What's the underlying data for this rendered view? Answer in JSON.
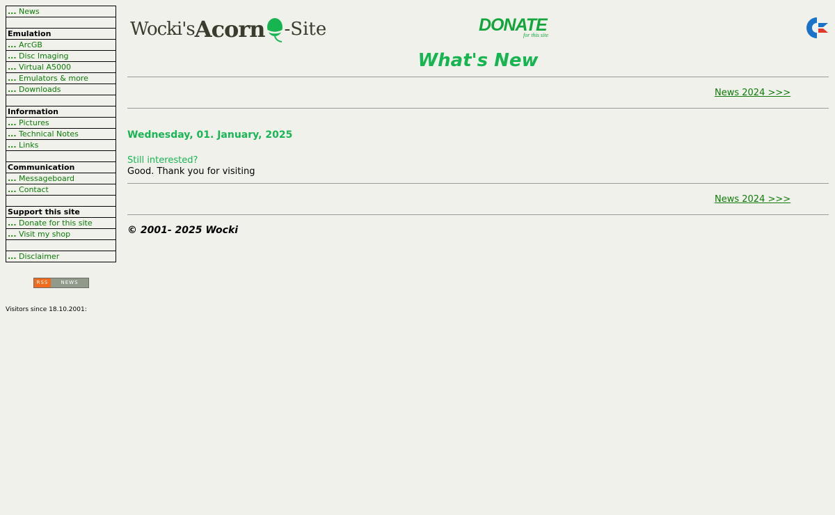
{
  "sidebar": {
    "rows": [
      {
        "type": "link",
        "prefix": "...",
        "label": "News"
      },
      {
        "type": "blank"
      },
      {
        "type": "head",
        "label": "Emulation"
      },
      {
        "type": "link",
        "prefix": "...",
        "label": "ArcGB"
      },
      {
        "type": "link",
        "prefix": "...",
        "label": "Disc Imaging"
      },
      {
        "type": "link",
        "prefix": "...",
        "label": "Virtual A5000"
      },
      {
        "type": "link",
        "prefix": "...",
        "label": "Emulators & more"
      },
      {
        "type": "link",
        "prefix": "...",
        "label": "Downloads"
      },
      {
        "type": "blank"
      },
      {
        "type": "head",
        "label": "Information"
      },
      {
        "type": "link",
        "prefix": "...",
        "label": "Pictures"
      },
      {
        "type": "link",
        "prefix": "...",
        "label": "Technical Notes"
      },
      {
        "type": "link",
        "prefix": "...",
        "label": "Links"
      },
      {
        "type": "blank"
      },
      {
        "type": "head",
        "label": "Communication"
      },
      {
        "type": "link",
        "prefix": "...",
        "label": "Messageboard"
      },
      {
        "type": "link",
        "prefix": "...",
        "label": "Contact"
      },
      {
        "type": "blank"
      },
      {
        "type": "head",
        "label": "Support this site"
      },
      {
        "type": "link",
        "prefix": "...",
        "label": "Donate for this site"
      },
      {
        "type": "link",
        "prefix": "...",
        "label": "Visit my shop"
      },
      {
        "type": "blank"
      },
      {
        "type": "link",
        "prefix": "...",
        "label": "Disclaimer"
      }
    ],
    "rss_badge": {
      "left": "RSS",
      "right": "NEWS"
    },
    "visitors_label": "Visitors since 18.10.2001:"
  },
  "header": {
    "logo": {
      "part1": "Wocki's",
      "part2": "Acorn",
      "part3": "-Site",
      "icon": "acorn-icon"
    },
    "donate": {
      "main": "DONATE",
      "sub": "for this site"
    },
    "right_logo_icon": "commodore-logo-icon"
  },
  "main": {
    "title": "What's New",
    "nav_link_top": "News 2024 >>>",
    "nav_link_bottom": "News 2024 >>>",
    "entry": {
      "date": "Wednesday, 01. January, 2025",
      "title": "Still interested?",
      "body": "Good. Thank you for visiting"
    },
    "copyright": "© 2001- 2025 Wocki"
  },
  "colors": {
    "background": "#f0f1eb",
    "accent_green": "#16b552",
    "link_green": "#0f7a0a",
    "commodore_blue": "#1a73c9",
    "commodore_red": "#e0382a"
  }
}
